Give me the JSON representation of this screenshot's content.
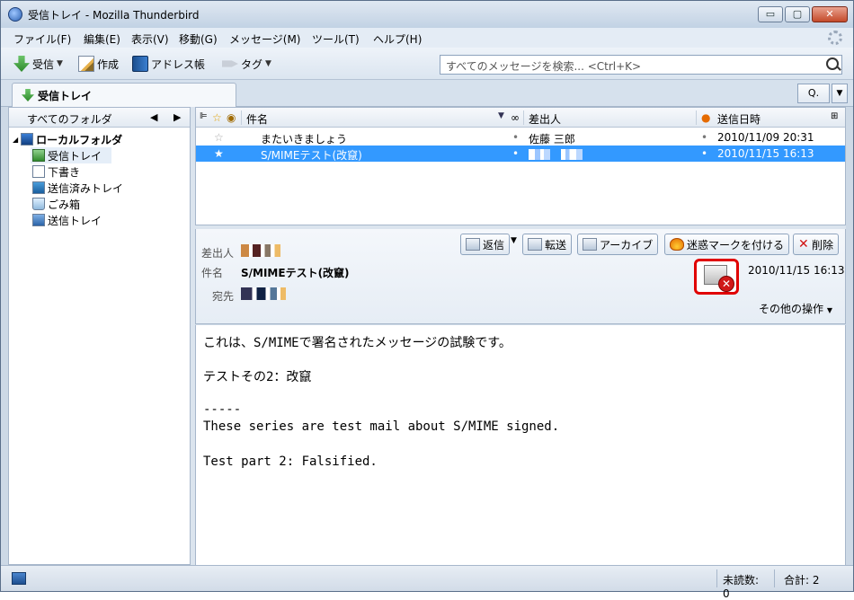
{
  "window": {
    "title": "受信トレイ - Mozilla Thunderbird",
    "min_label": "▭",
    "max_label": "▢",
    "close_label": "✕"
  },
  "menubar": {
    "items": [
      "ファイル(F)",
      "編集(E)",
      "表示(V)",
      "移動(G)",
      "メッセージ(M)",
      "ツール(T)",
      "ヘルプ(H)"
    ]
  },
  "toolbar": {
    "get_label": "受信",
    "write_label": "作成",
    "address_label": "アドレス帳",
    "tag_label": "タグ",
    "search_placeholder": "すべてのメッセージを検索... <Ctrl+K>"
  },
  "tabs": {
    "inbox_label": "受信トレイ",
    "quickfilter_label": "Q."
  },
  "folder_pane": {
    "header": "すべてのフォルダ",
    "root": "ローカルフォルダ",
    "folders": [
      "受信トレイ",
      "下書き",
      "送信済みトレイ",
      "ごみ箱",
      "送信トレイ"
    ]
  },
  "thread_pane": {
    "columns": {
      "subject": "件名",
      "from": "差出人",
      "date": "送信日時"
    },
    "rows": [
      {
        "subject": "またいきましょう",
        "from": "佐藤 三郎",
        "date": "2010/11/09 20:31"
      },
      {
        "subject": "S/MIMEテスト(改竄)",
        "from": "",
        "date": "2010/11/15 16:13"
      }
    ]
  },
  "message": {
    "from_label": "差出人",
    "subject_label": "件名",
    "to_label": "宛先",
    "subject": "S/MIMEテスト(改竄)",
    "date": "2010/11/15 16:13",
    "buttons": {
      "reply": "返信",
      "forward": "転送",
      "archive": "アーカイブ",
      "junk": "迷惑マークを付ける",
      "delete": "削除"
    },
    "more_actions": "その他の操作",
    "body": [
      "これは、S/MIMEで署名されたメッセージの試験です。",
      "テストその2：改竄",
      "-----",
      "These series are test mail about S/MIME signed.",
      "Test part 2: Falsified."
    ]
  },
  "statusbar": {
    "unread": "未読数: 0",
    "total": "合計: 2"
  },
  "colors": {
    "selection": "#3399ff",
    "error_red": "#e00000"
  }
}
